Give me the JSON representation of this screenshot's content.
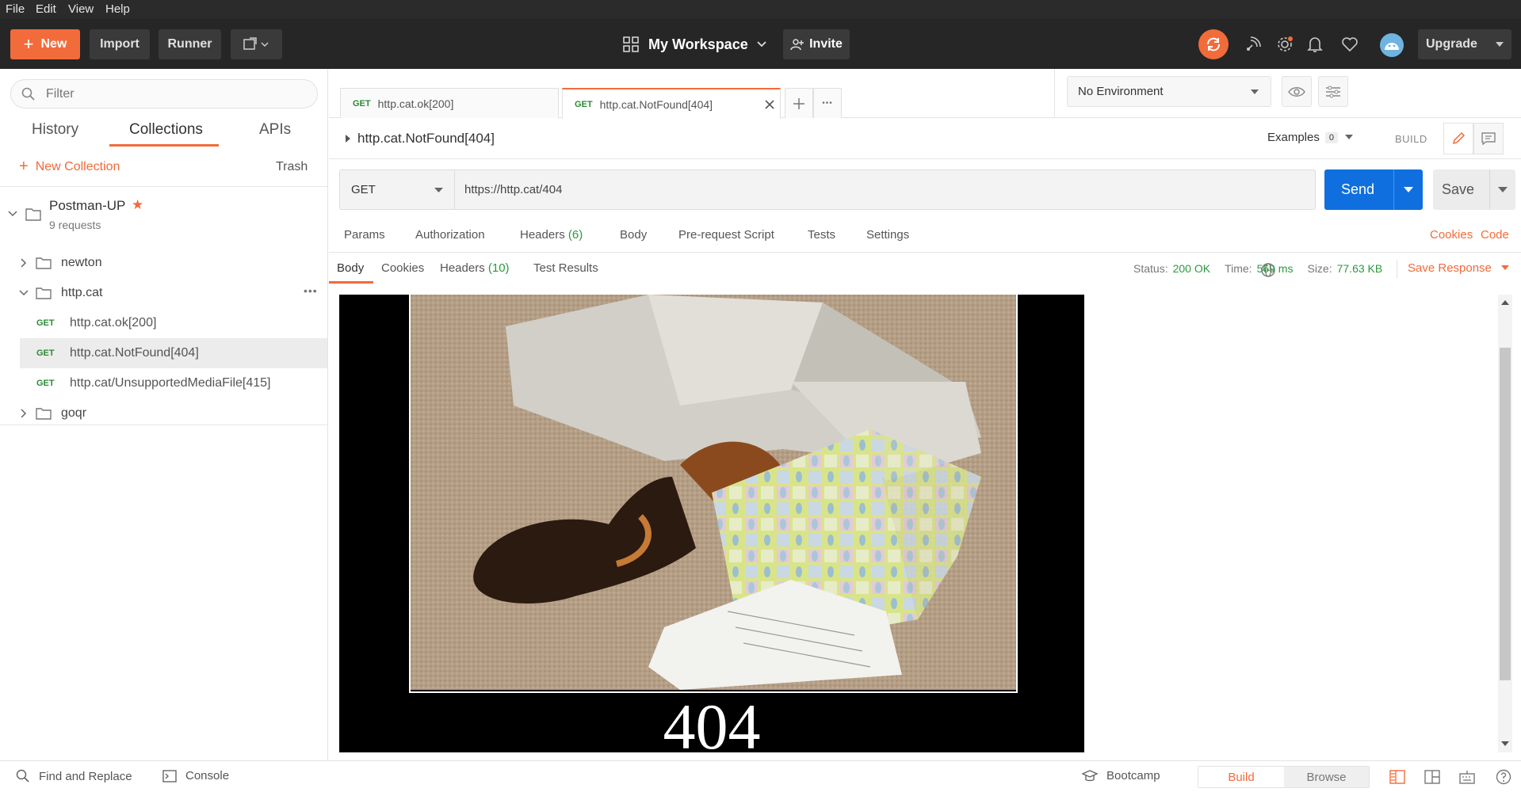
{
  "menu": [
    "File",
    "Edit",
    "View",
    "Help"
  ],
  "header": {
    "new_label": "New",
    "import_label": "Import",
    "runner_label": "Runner",
    "workspace_label": "My Workspace",
    "invite_label": "Invite",
    "upgrade_label": "Upgrade",
    "accent": "#f26b3a"
  },
  "sidebar": {
    "filter_placeholder": "Filter",
    "tabs": [
      "History",
      "Collections",
      "APIs"
    ],
    "new_collection_label": "New Collection",
    "trash_label": "Trash",
    "collection": {
      "name": "Postman-UP",
      "count": "9 requests"
    },
    "folders": {
      "newton": "newton",
      "httpcat": "http.cat",
      "goqr": "goqr"
    },
    "requests": [
      {
        "method": "GET",
        "name": "http.cat.ok[200]"
      },
      {
        "method": "GET",
        "name": "http.cat.NotFound[404]"
      },
      {
        "method": "GET",
        "name": "http.cat/UnsupportedMediaFile[415]"
      }
    ]
  },
  "tabs": [
    {
      "method": "GET",
      "name": "http.cat.ok[200]"
    },
    {
      "method": "GET",
      "name": "http.cat.NotFound[404]"
    }
  ],
  "environment": {
    "selected": "No Environment"
  },
  "request": {
    "title": "http.cat.NotFound[404]",
    "examples_label": "Examples",
    "examples_count": "0",
    "build_label": "BUILD",
    "method": "GET",
    "url": "https://http.cat/404",
    "send_label": "Send",
    "save_label": "Save",
    "subtabs": {
      "params": "Params",
      "authorization": "Authorization",
      "headers": "Headers",
      "headers_count": "(6)",
      "body": "Body",
      "prerequest": "Pre-request Script",
      "tests": "Tests",
      "settings": "Settings"
    },
    "cookies_link": "Cookies",
    "code_link": "Code"
  },
  "response": {
    "tabs": {
      "body": "Body",
      "cookies": "Cookies",
      "headers": "Headers",
      "headers_count": "(10)",
      "test_results": "Test Results"
    },
    "status_label": "Status:",
    "status_value": "200 OK",
    "time_label": "Time:",
    "time_value": "569 ms",
    "size_label": "Size:",
    "size_value": "77.63 KB",
    "save_response_label": "Save Response",
    "image_caption": "404"
  },
  "footer": {
    "find_replace": "Find and Replace",
    "console": "Console",
    "bootcamp": "Bootcamp",
    "build": "Build",
    "browse": "Browse"
  }
}
